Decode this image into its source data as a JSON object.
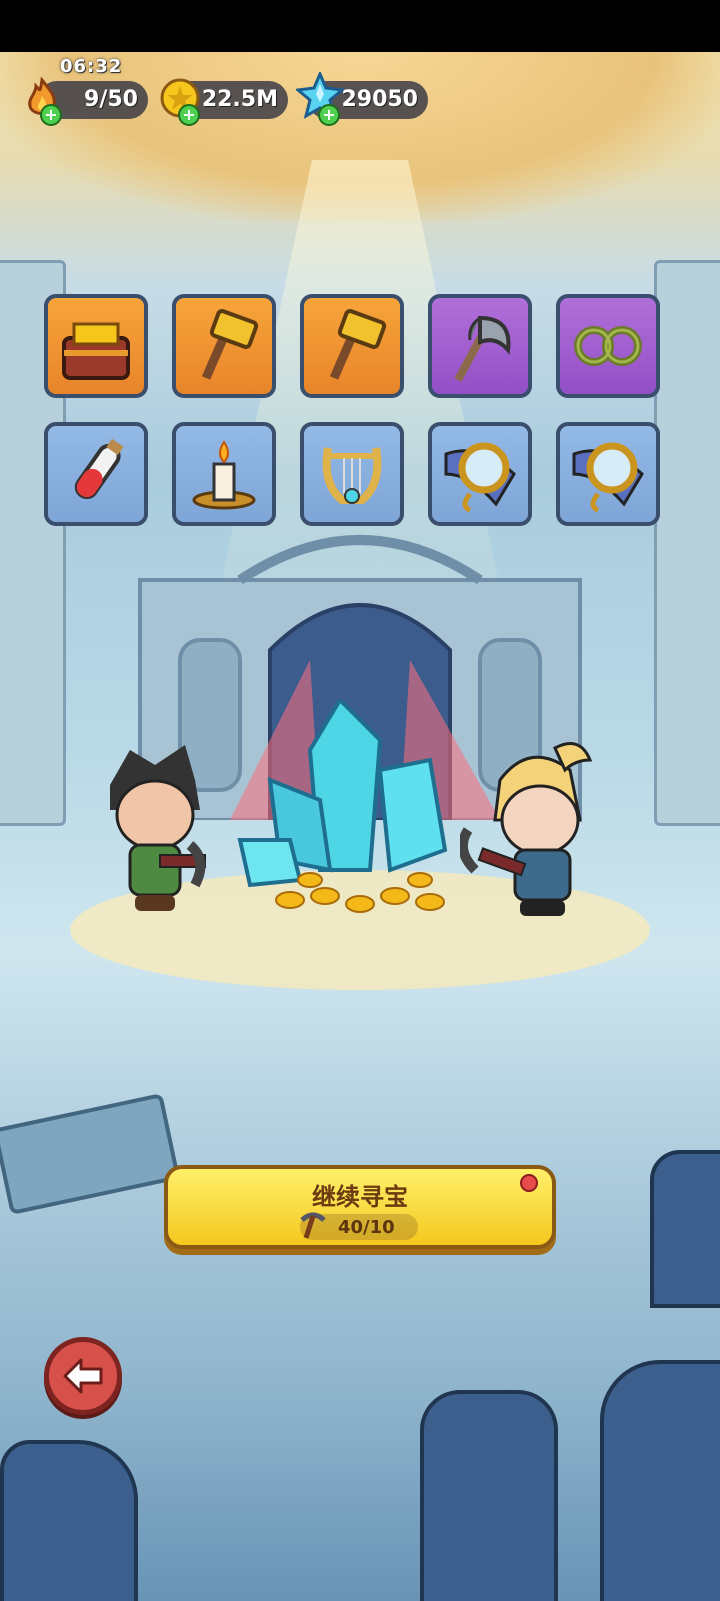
{
  "status": {
    "time": "06:32",
    "energy": "9/50",
    "gold": "22.5M",
    "gems": "29050"
  },
  "inventory": [
    {
      "rarity": "orange",
      "icon": "gold-treasure-chest-icon"
    },
    {
      "rarity": "orange",
      "icon": "golden-hammer-icon"
    },
    {
      "rarity": "orange",
      "icon": "golden-hammer-icon"
    },
    {
      "rarity": "purple",
      "icon": "battle-axe-icon"
    },
    {
      "rarity": "purple",
      "icon": "thorn-vine-icon"
    },
    {
      "rarity": "blue",
      "icon": "red-potion-vial-icon"
    },
    {
      "rarity": "blue",
      "icon": "candle-holder-icon"
    },
    {
      "rarity": "blue",
      "icon": "golden-lyre-icon"
    },
    {
      "rarity": "blue",
      "icon": "magic-mirror-icon"
    },
    {
      "rarity": "blue",
      "icon": "magic-mirror-icon"
    }
  ],
  "continue_button": {
    "label": "继续寻宝",
    "pickaxes": "40/10"
  },
  "colors": {
    "button_yellow": "#f5c81f",
    "crystal": "#4fd6e6",
    "back_red": "#d8504a"
  }
}
